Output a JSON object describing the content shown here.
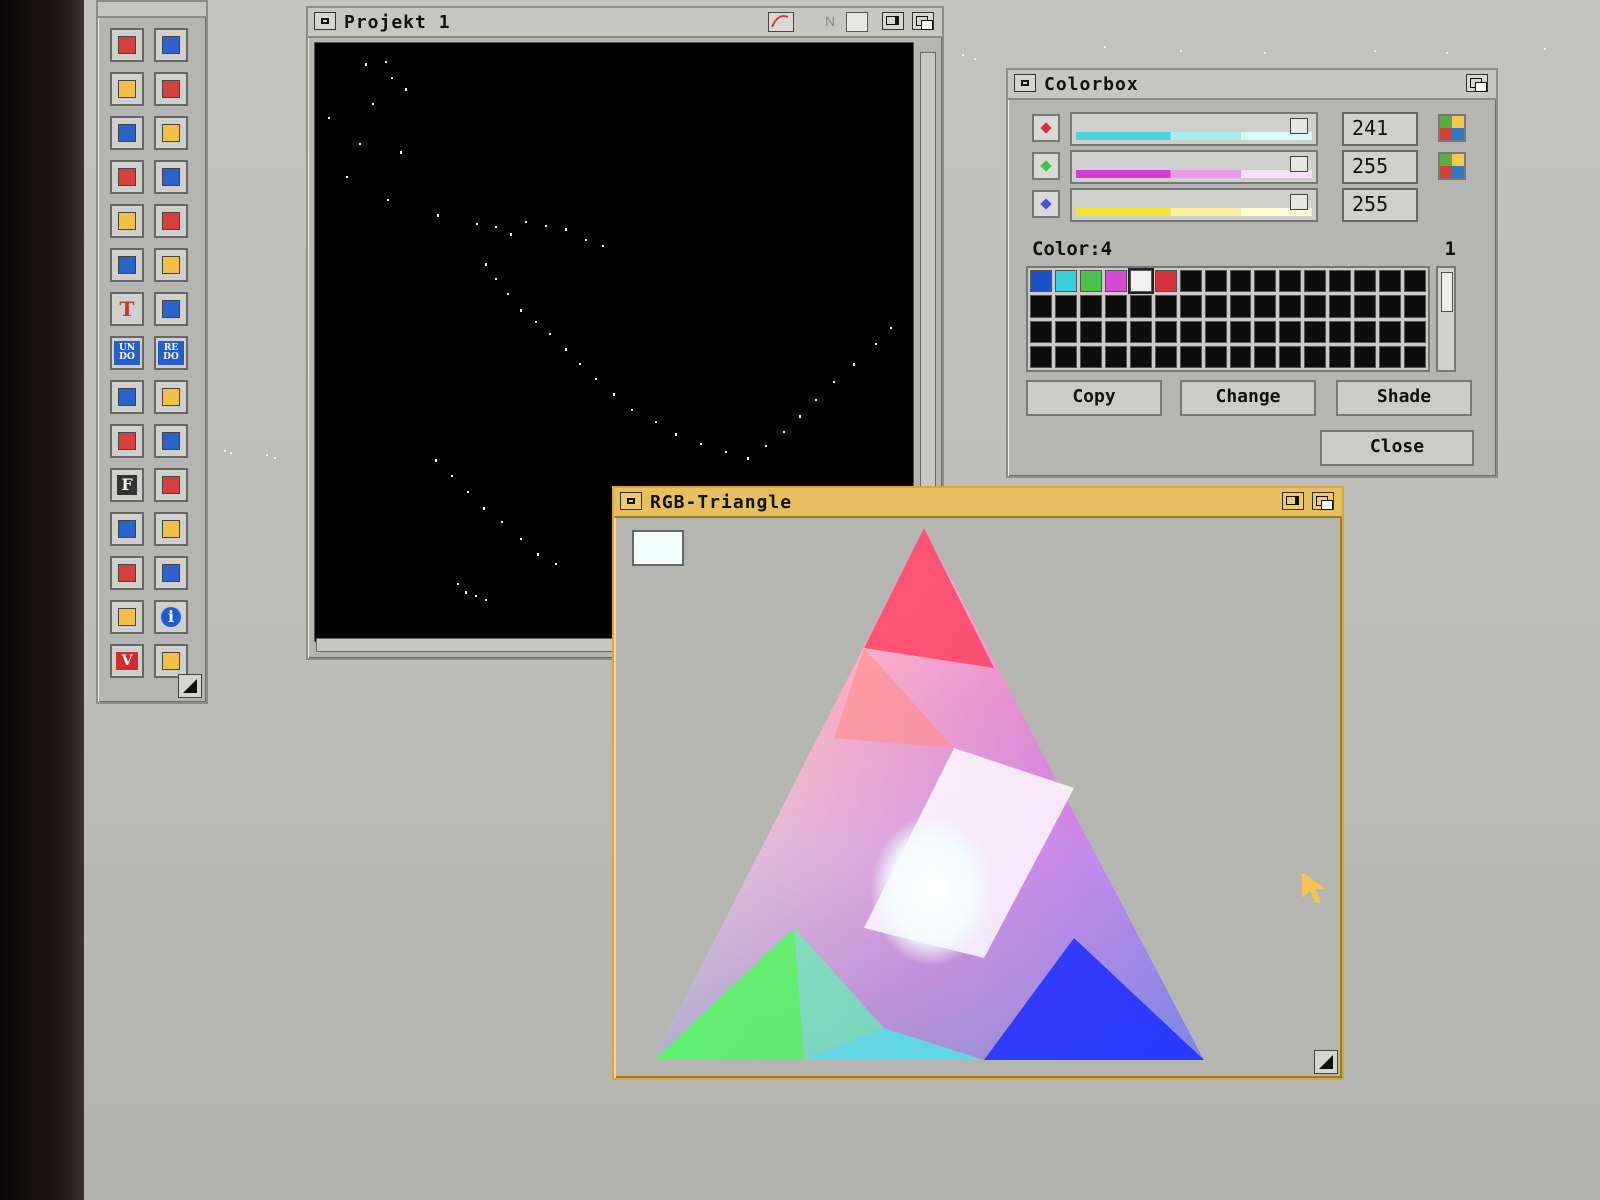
{
  "toolbox": {
    "tools": [
      {
        "icon": "dotted-line-icon"
      },
      {
        "icon": "curve-icon"
      },
      {
        "icon": "line-icon"
      },
      {
        "icon": "arc-icon"
      },
      {
        "icon": "rectangle-icon"
      },
      {
        "icon": "circle-icon"
      },
      {
        "icon": "diamond-icon"
      },
      {
        "icon": "fill-icon"
      },
      {
        "icon": "magnify-icon"
      },
      {
        "icon": "transform-icon"
      },
      {
        "icon": "mirror-icon"
      },
      {
        "icon": "brush-icon"
      },
      {
        "icon": "text-icon",
        "label": "T"
      },
      {
        "icon": "target-icon"
      },
      {
        "icon": "undo-icon",
        "label": "UN DO"
      },
      {
        "icon": "redo-icon",
        "label": "RE DO"
      },
      {
        "icon": "sphere-icon"
      },
      {
        "icon": "bulb-icon"
      },
      {
        "icon": "scissors-icon"
      },
      {
        "icon": "edit-icon"
      },
      {
        "icon": "font-icon",
        "label": "F"
      },
      {
        "icon": "view-icon"
      },
      {
        "icon": "compass-icon"
      },
      {
        "icon": "shape-icon"
      },
      {
        "icon": "cube-icon"
      },
      {
        "icon": "palette-icon"
      },
      {
        "icon": "grid-icon"
      },
      {
        "icon": "info-icon",
        "label": "i"
      },
      {
        "icon": "triangle-icon",
        "label": "V"
      },
      {
        "icon": "monitor-icon"
      }
    ]
  },
  "projekt_window": {
    "title": "Projekt 1"
  },
  "colorbox_window": {
    "title": "Colorbox",
    "rgb": [
      {
        "label": "241"
      },
      {
        "label": "255"
      },
      {
        "label": "255"
      }
    ],
    "color_label": "Color:4",
    "color_page": "1",
    "buttons": {
      "copy": "Copy",
      "change": "Change",
      "shade": "Shade",
      "close": "Close"
    },
    "palette_colors": [
      "#1d52c7",
      "#37cfd8",
      "#4bc24f",
      "#d64ad8",
      "#f1f1f1",
      "#d8323d"
    ]
  },
  "rgb_window": {
    "title": "RGB-Triangle",
    "selected_color": "#f1ffff"
  }
}
